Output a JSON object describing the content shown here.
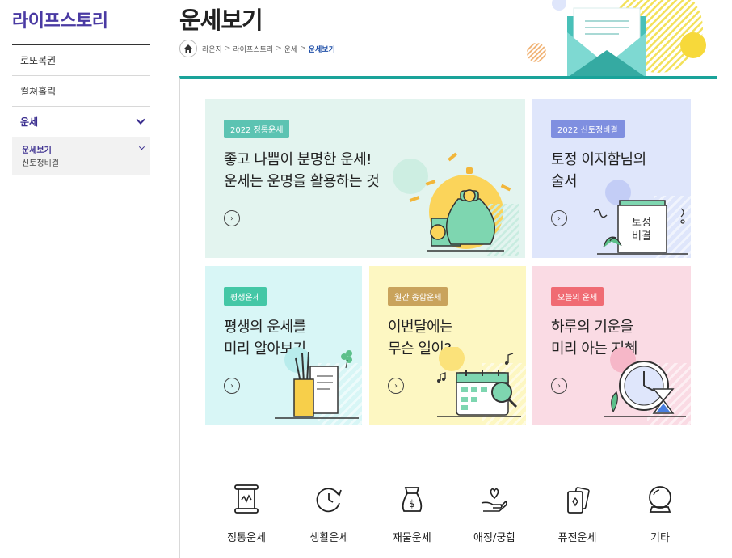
{
  "sidebar": {
    "title": "라이프스토리",
    "items": [
      {
        "label": "로또복권"
      },
      {
        "label": "컬쳐홀릭"
      },
      {
        "label": "운세"
      }
    ],
    "sub_items": [
      {
        "label": "운세보기"
      },
      {
        "label": "신토정비결"
      }
    ]
  },
  "header": {
    "title": "운세보기",
    "breadcrumb": [
      "라운지",
      "라이프스토리",
      "운세",
      "운세보기"
    ],
    "breadcrumb_sep": ">"
  },
  "cards": [
    {
      "badge": "2022 정통운세",
      "line1": "좋고 나쁨이 분명한 운세!",
      "line2": "운세는 운명을 활용하는 것",
      "bg": "#e3f4ef",
      "badge_color": "#5cc3b2"
    },
    {
      "badge": "2022 신토정비결",
      "line1": "토정 이지함님의",
      "line2": "술서",
      "bg": "#dfe6fb",
      "badge_color": "#7f8fe0",
      "book_line1": "토정",
      "book_line2": "비결"
    },
    {
      "badge": "평생운세",
      "line1": "평생의 운세를",
      "line2": "미리 알아보기",
      "bg": "#d8f6f6",
      "badge_color": "#44c7a6"
    },
    {
      "badge": "월간 종합운세",
      "line1": "이번달에는",
      "line2": "무슨 일이?",
      "bg": "#fdf7c2",
      "badge_color": "#c9a35c"
    },
    {
      "badge": "오늘의 운세",
      "line1": "하루의 기운을",
      "line2": "미리 아는 지혜",
      "bg": "#fadbe4",
      "badge_color": "#f06b73"
    }
  ],
  "arrow_glyph": "›",
  "categories": [
    {
      "label": "정통운세",
      "icon": "scroll-icon"
    },
    {
      "label": "생활운세",
      "icon": "refresh-clock-icon"
    },
    {
      "label": "재물운세",
      "icon": "money-bag-icon"
    },
    {
      "label": "애정/궁합",
      "icon": "heart-hand-icon"
    },
    {
      "label": "퓨전운세",
      "icon": "cards-icon"
    },
    {
      "label": "기타",
      "icon": "crystal-ball-icon"
    }
  ],
  "colors": {
    "accent": "#1aa39a",
    "brand": "#4a3aa3",
    "link": "#1f4fa8"
  }
}
